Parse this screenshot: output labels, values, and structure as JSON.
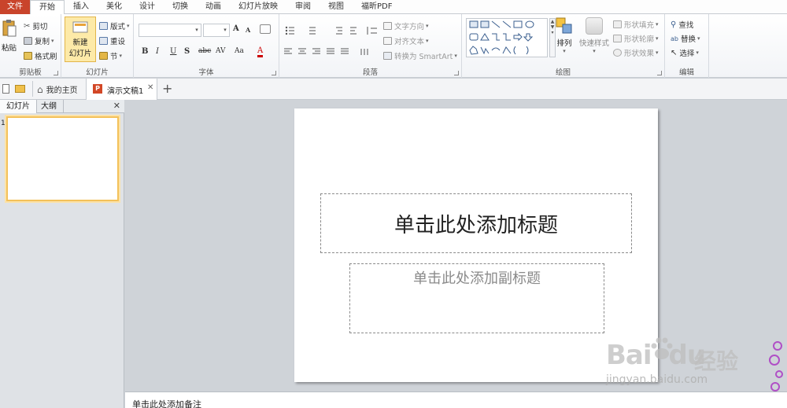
{
  "menu": {
    "tabs": [
      "文件",
      "开始",
      "插入",
      "美化",
      "设计",
      "切换",
      "动画",
      "幻灯片放映",
      "审阅",
      "视图",
      "福昕PDF"
    ],
    "active": "开始"
  },
  "ribbon": {
    "clipboard": {
      "label": "剪贴板",
      "paste": "粘贴",
      "cut": "剪切",
      "copy": "复制",
      "format_painter": "格式刷"
    },
    "slides": {
      "label": "幻灯片",
      "new_slide_line1": "新建",
      "new_slide_line2": "幻灯片",
      "layout": "版式",
      "reset": "重设",
      "section": "节"
    },
    "font": {
      "label": "字体",
      "bold": "B",
      "italic": "I",
      "underline": "U",
      "shadow": "S",
      "strike": "abc",
      "spacing": "AV",
      "case": "Aa",
      "grow": "A",
      "shrink": "A",
      "color": "A"
    },
    "paragraph": {
      "label": "段落",
      "text_direction": "文字方向",
      "align_text": "对齐文本",
      "smartart": "转换为 SmartArt"
    },
    "drawing": {
      "label": "绘图",
      "arrange": "排列",
      "quick_styles": "快速样式",
      "shape_fill": "形状填充",
      "shape_outline": "形状轮廓",
      "shape_effects": "形状效果"
    },
    "editing": {
      "label": "编辑",
      "find": "查找",
      "replace": "替换",
      "select": "选择"
    }
  },
  "doc_tabs": {
    "home": "我的主页",
    "doc": "演示文稿1",
    "close": "✕",
    "add": "+"
  },
  "left_panel": {
    "tab_slides": "幻灯片",
    "tab_outline": "大纲",
    "close": "✕",
    "slide_number": "1"
  },
  "slide": {
    "title_placeholder": "单击此处添加标题",
    "subtitle_placeholder": "单击此处添加副标题"
  },
  "notes": {
    "placeholder": "单击此处添加备注"
  },
  "watermark": {
    "main": "Bai",
    "main_tail": "du",
    "cn": "经验",
    "url": "jingyan.baidu.com"
  },
  "colors": {
    "file_tab": "#c9442b",
    "accent_yellow": "#f3c15a",
    "ribbon_bg": "#f2f4f7",
    "workspace": "#cfd3d8"
  }
}
